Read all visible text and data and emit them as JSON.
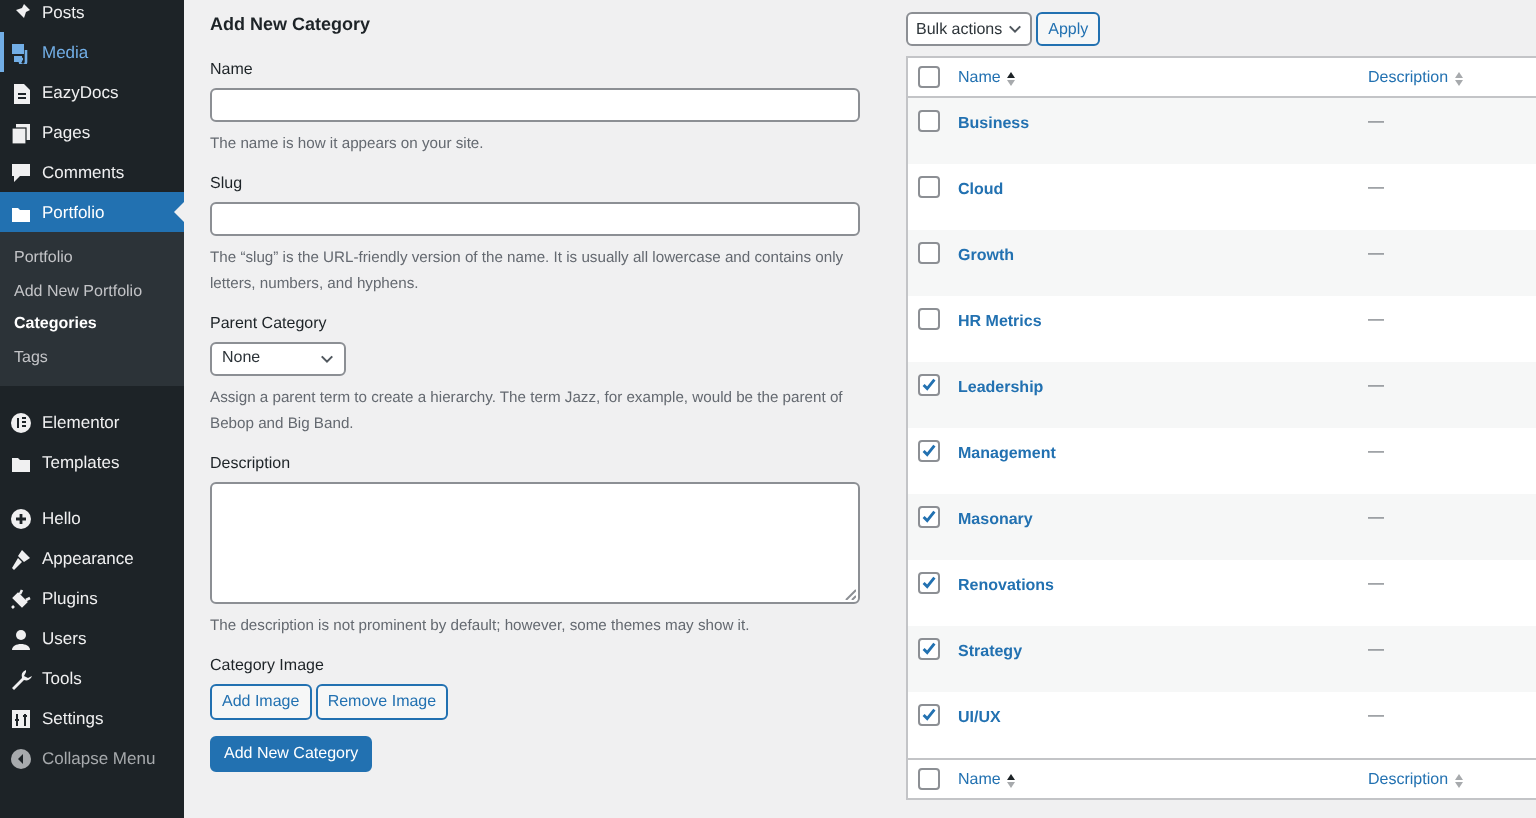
{
  "sidebar": {
    "sections": [
      {
        "items": [
          {
            "label": "Posts",
            "selected": false,
            "hovered": false
          },
          {
            "label": "Media",
            "selected": false,
            "hovered": true
          },
          {
            "label": "EazyDocs",
            "selected": false,
            "hovered": false
          },
          {
            "label": "Pages",
            "selected": false,
            "hovered": false
          },
          {
            "label": "Comments",
            "selected": false,
            "hovered": false
          },
          {
            "label": "Portfolio",
            "selected": true,
            "hovered": false,
            "children": [
              {
                "label": "Portfolio",
                "selected": false
              },
              {
                "label": "Add New Portfolio",
                "selected": false
              },
              {
                "label": "Categories",
                "selected": true
              },
              {
                "label": "Tags",
                "selected": false
              }
            ]
          }
        ]
      },
      {
        "items": [
          {
            "label": "Elementor",
            "selected": false,
            "hovered": false
          },
          {
            "label": "Templates",
            "selected": false,
            "hovered": false
          }
        ]
      },
      {
        "items": [
          {
            "label": "Hello",
            "selected": false,
            "hovered": false
          },
          {
            "label": "Appearance",
            "selected": false,
            "hovered": false
          },
          {
            "label": "Plugins",
            "selected": false,
            "hovered": false
          },
          {
            "label": "Users",
            "selected": false,
            "hovered": false
          },
          {
            "label": "Tools",
            "selected": false,
            "hovered": false
          },
          {
            "label": "Settings",
            "selected": false,
            "hovered": false
          },
          {
            "label": "Collapse Menu",
            "selected": false,
            "hovered": false,
            "kind": "collapse"
          }
        ]
      }
    ]
  },
  "form": {
    "title": "Add New Category",
    "fields": [
      {
        "kind": "text",
        "label": "Name",
        "help": "The name is how it appears on your site."
      },
      {
        "kind": "text",
        "label": "Slug",
        "help": "The “slug” is the URL-friendly version of the name. It is usually all lowercase and contains only letters, numbers, and hyphens."
      },
      {
        "kind": "select",
        "label": "Parent Category",
        "value": "None",
        "help": "Assign a parent term to create a hierarchy. The term Jazz, for example, would be the parent of Bebop and Big Band."
      },
      {
        "kind": "textarea",
        "label": "Description",
        "help": "The description is not prominent by default; however, some themes may show it."
      },
      {
        "kind": "image",
        "label": "Category Image",
        "buttons": [
          "Add Image",
          "Remove Image"
        ]
      }
    ],
    "submit": "Add New Category"
  },
  "bulk_actions": {
    "value": "Bulk actions",
    "apply": "Apply"
  },
  "table": {
    "header": {
      "checked": false,
      "columns": [
        {
          "label": "Name",
          "sorted": true
        },
        {
          "label": "Description",
          "sorted": false
        }
      ]
    },
    "rows": [
      {
        "name": "Business",
        "description": "—",
        "checked": false
      },
      {
        "name": "Cloud",
        "description": "—",
        "checked": false
      },
      {
        "name": "Growth",
        "description": "—",
        "checked": false
      },
      {
        "name": "HR Metrics",
        "description": "—",
        "checked": false
      },
      {
        "name": "Leadership",
        "description": "—",
        "checked": true
      },
      {
        "name": "Management",
        "description": "—",
        "checked": true
      },
      {
        "name": "Masonary",
        "description": "—",
        "checked": true
      },
      {
        "name": "Renovations",
        "description": "—",
        "checked": true
      },
      {
        "name": "Strategy",
        "description": "—",
        "checked": true
      },
      {
        "name": "UI/UX",
        "description": "—",
        "checked": true
      }
    ],
    "footer": {
      "checked": false,
      "columns": [
        {
          "label": "Name",
          "sorted": true
        },
        {
          "label": "Description",
          "sorted": false
        }
      ]
    }
  }
}
